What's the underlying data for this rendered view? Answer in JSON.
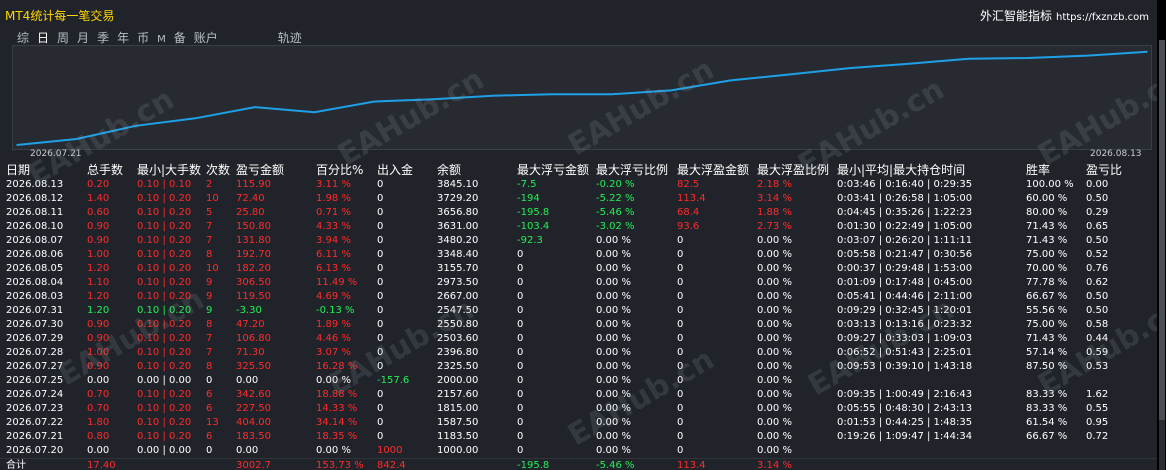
{
  "header": {
    "title": "MT4统计每一笔交易",
    "brand": "外汇智能指标",
    "url": "https://fxznzb.com"
  },
  "tabs": [
    {
      "label": "综",
      "active": false,
      "small": false
    },
    {
      "label": "日",
      "active": true,
      "small": false
    },
    {
      "label": "周",
      "active": false,
      "small": false
    },
    {
      "label": "月",
      "active": false,
      "small": false
    },
    {
      "label": "季",
      "active": false,
      "small": false
    },
    {
      "label": "年",
      "active": false,
      "small": false
    },
    {
      "label": "币",
      "active": false,
      "small": false
    },
    {
      "label": "M",
      "active": false,
      "small": true
    },
    {
      "label": "备",
      "active": false,
      "small": false
    },
    {
      "label": "账户",
      "active": false,
      "small": false
    }
  ],
  "track_label": "轨迹",
  "watermark": "EAHub.cn",
  "colors": {
    "accent_line": "#1ea0e6",
    "profit": "#ff2a2a",
    "loss": "#22ee55",
    "title": "#ffd700",
    "panel_bg": "#20242a"
  },
  "chart_data": {
    "type": "line",
    "x_start_label": "2026.07.21",
    "x_end_label": "2026.08.13",
    "x": [
      "2026.07.20",
      "2026.07.21",
      "2026.07.22",
      "2026.07.23",
      "2026.07.24",
      "2026.07.25",
      "2026.07.27",
      "2026.07.28",
      "2026.07.29",
      "2026.07.30",
      "2026.07.31",
      "2026.08.03",
      "2026.08.04",
      "2026.08.05",
      "2026.08.06",
      "2026.08.07",
      "2026.08.10",
      "2026.08.11",
      "2026.08.12",
      "2026.08.13"
    ],
    "values": [
      1000.0,
      1183.5,
      1587.5,
      1815.0,
      2157.6,
      2000.0,
      2325.5,
      2396.8,
      2503.6,
      2550.8,
      2547.5,
      2667.0,
      2973.5,
      3155.7,
      3348.4,
      3480.2,
      3631.0,
      3656.8,
      3729.2,
      3845.1
    ],
    "ylim": [
      1000,
      3900
    ]
  },
  "columns": [
    "日期",
    "总手数",
    "最小|大手数",
    "次数",
    "盈亏金额",
    "百分比%",
    "出入金",
    "余额",
    "最大浮亏金额",
    "最大浮亏比例",
    "最大浮盈金额",
    "最大浮盈比例",
    "最小|平均|最大持仓时间",
    "胜率",
    "盈亏比"
  ],
  "rows": [
    {
      "date": "2026.08.13",
      "lots": "0.20",
      "range": "0.10 | 0.10",
      "count": "2",
      "pl": "115.90",
      "pct": "3.11 %",
      "io": "0",
      "bal": "3845.10",
      "fl": "-7.5",
      "flpct": "-0.20 %",
      "fp": "82.5",
      "fppct": "2.18 %",
      "hold": "0:03:46 | 0:16:40 | 0:29:35",
      "win": "100.00 %",
      "ratio": "0.00",
      "tone": "red"
    },
    {
      "date": "2026.08.12",
      "lots": "1.40",
      "range": "0.10 | 0.20",
      "count": "10",
      "pl": "72.40",
      "pct": "1.98 %",
      "io": "0",
      "bal": "3729.20",
      "fl": "-194",
      "flpct": "-5.22 %",
      "fp": "113.4",
      "fppct": "3.14 %",
      "hold": "0:03:41 | 0:26:58 | 1:05:00",
      "win": "60.00 %",
      "ratio": "0.50",
      "tone": "red"
    },
    {
      "date": "2026.08.11",
      "lots": "0.60",
      "range": "0.10 | 0.20",
      "count": "5",
      "pl": "25.80",
      "pct": "0.71 %",
      "io": "0",
      "bal": "3656.80",
      "fl": "-195.8",
      "flpct": "-5.46 %",
      "fp": "68.4",
      "fppct": "1.88 %",
      "hold": "0:04:45 | 0:35:26 | 1:22:23",
      "win": "80.00 %",
      "ratio": "0.29",
      "tone": "red"
    },
    {
      "date": "2026.08.10",
      "lots": "0.90",
      "range": "0.10 | 0.20",
      "count": "7",
      "pl": "150.80",
      "pct": "4.33 %",
      "io": "0",
      "bal": "3631.00",
      "fl": "-103.4",
      "flpct": "-3.02 %",
      "fp": "93.6",
      "fppct": "2.73 %",
      "hold": "0:01:30 | 0:22:49 | 1:05:00",
      "win": "71.43 %",
      "ratio": "0.65",
      "tone": "red"
    },
    {
      "date": "2026.08.07",
      "lots": "0.90",
      "range": "0.10 | 0.20",
      "count": "7",
      "pl": "131.80",
      "pct": "3.94 %",
      "io": "0",
      "bal": "3480.20",
      "fl": "-92.3",
      "flpct": "0.00 %",
      "fp": "0",
      "fppct": "0.00 %",
      "hold": "0:03:07 | 0:26:20 | 1:11:11",
      "win": "71.43 %",
      "ratio": "0.50",
      "tone": "red"
    },
    {
      "date": "2026.08.06",
      "lots": "1.00",
      "range": "0.10 | 0.20",
      "count": "8",
      "pl": "192.70",
      "pct": "6.11 %",
      "io": "0",
      "bal": "3348.40",
      "fl": "0",
      "flpct": "0.00 %",
      "fp": "0",
      "fppct": "0.00 %",
      "hold": "0:05:58 | 0:21:47 | 0:30:56",
      "win": "75.00 %",
      "ratio": "0.52",
      "tone": "red"
    },
    {
      "date": "2026.08.05",
      "lots": "1.20",
      "range": "0.10 | 0.20",
      "count": "10",
      "pl": "182.20",
      "pct": "6.13 %",
      "io": "0",
      "bal": "3155.70",
      "fl": "0",
      "flpct": "0.00 %",
      "fp": "0",
      "fppct": "0.00 %",
      "hold": "0:00:37 | 0:29:48 | 1:53:00",
      "win": "70.00 %",
      "ratio": "0.76",
      "tone": "red"
    },
    {
      "date": "2026.08.04",
      "lots": "1.10",
      "range": "0.10 | 0.20",
      "count": "9",
      "pl": "306.50",
      "pct": "11.49 %",
      "io": "0",
      "bal": "2973.50",
      "fl": "0",
      "flpct": "0.00 %",
      "fp": "0",
      "fppct": "0.00 %",
      "hold": "0:01:09 | 0:17:48 | 0:45:00",
      "win": "77.78 %",
      "ratio": "0.62",
      "tone": "red"
    },
    {
      "date": "2026.08.03",
      "lots": "1.20",
      "range": "0.10 | 0.20",
      "count": "9",
      "pl": "119.50",
      "pct": "4.69 %",
      "io": "0",
      "bal": "2667.00",
      "fl": "0",
      "flpct": "0.00 %",
      "fp": "0",
      "fppct": "0.00 %",
      "hold": "0:05:41 | 0:44:46 | 2:11:00",
      "win": "66.67 %",
      "ratio": "0.50",
      "tone": "red"
    },
    {
      "date": "2026.07.31",
      "lots": "1.20",
      "range": "0.10 | 0.20",
      "count": "9",
      "pl": "-3.30",
      "pct": "-0.13 %",
      "io": "0",
      "bal": "2547.50",
      "fl": "0",
      "flpct": "0.00 %",
      "fp": "0",
      "fppct": "0.00 %",
      "hold": "0:09:29 | 0:32:45 | 1:20:01",
      "win": "55.56 %",
      "ratio": "0.50",
      "tone": "green"
    },
    {
      "date": "2026.07.30",
      "lots": "0.90",
      "range": "0.10 | 0.20",
      "count": "8",
      "pl": "47.20",
      "pct": "1.89 %",
      "io": "0",
      "bal": "2550.80",
      "fl": "0",
      "flpct": "0.00 %",
      "fp": "0",
      "fppct": "0.00 %",
      "hold": "0:03:13 | 0:13:16 | 0:23:32",
      "win": "75.00 %",
      "ratio": "0.58",
      "tone": "red"
    },
    {
      "date": "2026.07.29",
      "lots": "0.90",
      "range": "0.10 | 0.20",
      "count": "7",
      "pl": "106.80",
      "pct": "4.46 %",
      "io": "0",
      "bal": "2503.60",
      "fl": "0",
      "flpct": "0.00 %",
      "fp": "0",
      "fppct": "0.00 %",
      "hold": "0:09:27 | 0:33:03 | 1:09:03",
      "win": "71.43 %",
      "ratio": "0.44",
      "tone": "red"
    },
    {
      "date": "2026.07.28",
      "lots": "1.00",
      "range": "0.10 | 0.20",
      "count": "7",
      "pl": "71.30",
      "pct": "3.07 %",
      "io": "0",
      "bal": "2396.80",
      "fl": "0",
      "flpct": "0.00 %",
      "fp": "0",
      "fppct": "0.00 %",
      "hold": "0:06:52 | 0:51:43 | 2:25:01",
      "win": "57.14 %",
      "ratio": "0.59",
      "tone": "red"
    },
    {
      "date": "2026.07.27",
      "lots": "0.90",
      "range": "0.10 | 0.20",
      "count": "8",
      "pl": "325.50",
      "pct": "16.28 %",
      "io": "0",
      "bal": "2325.50",
      "fl": "0",
      "flpct": "0.00 %",
      "fp": "0",
      "fppct": "0.00 %",
      "hold": "0:09:53 | 0:39:10 | 1:43:18",
      "win": "87.50 %",
      "ratio": "0.53",
      "tone": "red"
    },
    {
      "date": "2026.07.25",
      "lots": "0.00",
      "range": "0.00 | 0.00",
      "count": "0",
      "pl": "0.00",
      "pct": "0.00 %",
      "io": "-157.6",
      "bal": "2000.00",
      "fl": "0",
      "flpct": "0.00 %",
      "fp": "0",
      "fppct": "0.00 %",
      "hold": "",
      "win": "",
      "ratio": "",
      "tone": "white",
      "io_tone": "green"
    },
    {
      "date": "2026.07.24",
      "lots": "0.70",
      "range": "0.10 | 0.20",
      "count": "6",
      "pl": "342.60",
      "pct": "18.88 %",
      "io": "0",
      "bal": "2157.60",
      "fl": "0",
      "flpct": "0.00 %",
      "fp": "0",
      "fppct": "0.00 %",
      "hold": "0:09:35 | 1:00:49 | 2:16:43",
      "win": "83.33 %",
      "ratio": "1.62",
      "tone": "red"
    },
    {
      "date": "2026.07.23",
      "lots": "0.70",
      "range": "0.10 | 0.20",
      "count": "6",
      "pl": "227.50",
      "pct": "14.33 %",
      "io": "0",
      "bal": "1815.00",
      "fl": "0",
      "flpct": "0.00 %",
      "fp": "0",
      "fppct": "0.00 %",
      "hold": "0:05:55 | 0:48:30 | 2:43:13",
      "win": "83.33 %",
      "ratio": "0.55",
      "tone": "red"
    },
    {
      "date": "2026.07.22",
      "lots": "1.80",
      "range": "0.10 | 0.20",
      "count": "13",
      "pl": "404.00",
      "pct": "34.14 %",
      "io": "0",
      "bal": "1587.50",
      "fl": "0",
      "flpct": "0.00 %",
      "fp": "0",
      "fppct": "0.00 %",
      "hold": "0:01:53 | 0:44:25 | 1:48:35",
      "win": "61.54 %",
      "ratio": "0.95",
      "tone": "red"
    },
    {
      "date": "2026.07.21",
      "lots": "0.80",
      "range": "0.10 | 0.20",
      "count": "6",
      "pl": "183.50",
      "pct": "18.35 %",
      "io": "0",
      "bal": "1183.50",
      "fl": "0",
      "flpct": "0.00 %",
      "fp": "0",
      "fppct": "0.00 %",
      "hold": "0:19:26 | 1:09:47 | 1:44:34",
      "win": "66.67 %",
      "ratio": "0.72",
      "tone": "red"
    },
    {
      "date": "2026.07.20",
      "lots": "0.00",
      "range": "0.00 | 0.00",
      "count": "0",
      "pl": "0.00",
      "pct": "0.00 %",
      "io": "1000",
      "bal": "1000.00",
      "fl": "0",
      "flpct": "0.00 %",
      "fp": "0",
      "fppct": "0.00 %",
      "hold": "",
      "win": "",
      "ratio": "",
      "tone": "white",
      "io_tone": "red"
    }
  ],
  "total": {
    "label": "合计",
    "lots": "17.40",
    "pl": "3002.7",
    "pct": "153.73 %",
    "io": "842.4",
    "fl": "-195.8",
    "flpct": "-5.46 %",
    "fp": "113.4",
    "fppct": "3.14 %"
  }
}
